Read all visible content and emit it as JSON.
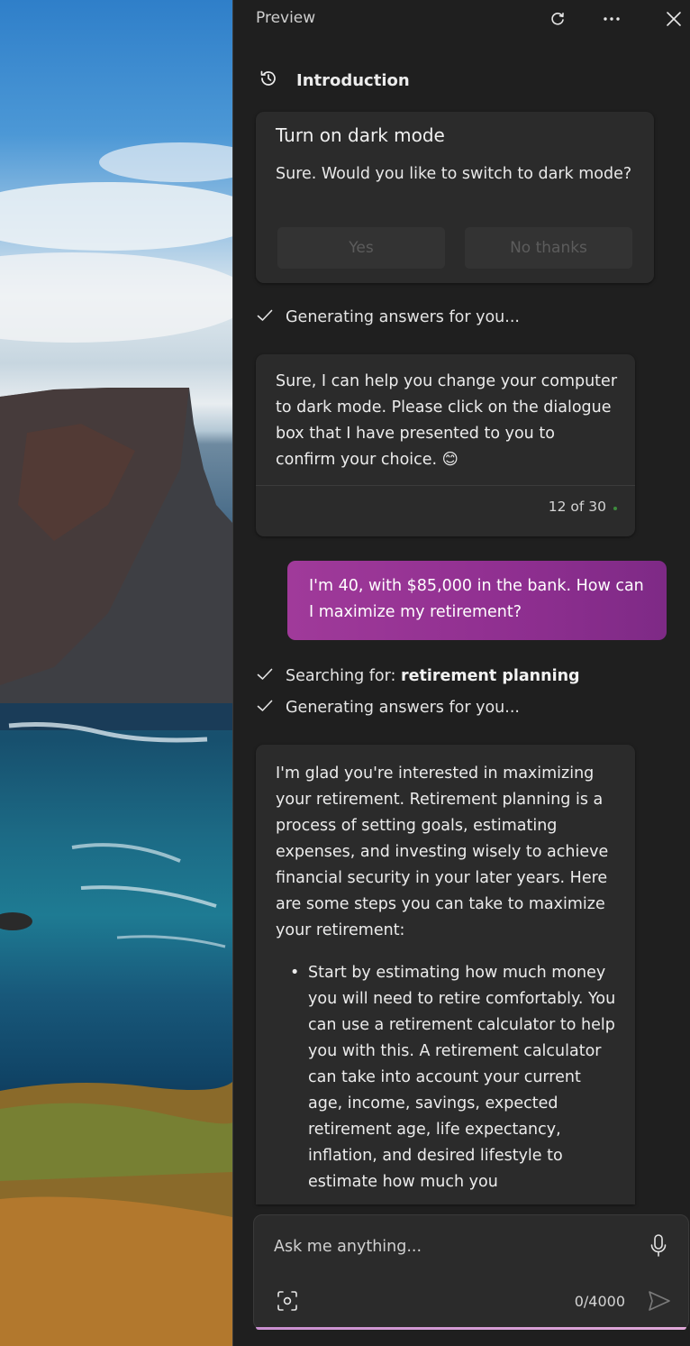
{
  "panel": {
    "title": "Preview"
  },
  "section": {
    "label": "Introduction"
  },
  "dialog_card": {
    "heading": "Turn on dark mode",
    "body": "Sure. Would you like to switch to dark mode?",
    "yes_label": "Yes",
    "no_label": "No thanks"
  },
  "status_1": {
    "text": "Generating answers for you..."
  },
  "answer_card_1": {
    "body": "Sure, I can help you change your computer to dark mode. Please click on the dialogue box that I have presented to you to confirm your choice. 😊",
    "count": "12 of 30"
  },
  "user_message": {
    "body": "I'm 40, with $85,000 in the bank. How can I maximize my retirement?"
  },
  "status_2": {
    "prefix": "Searching for: ",
    "query": "retirement planning"
  },
  "status_3": {
    "text": "Generating answers for you..."
  },
  "answer_card_2": {
    "paragraph": "I'm glad you're interested in maximizing your retirement. Retirement planning is a process of setting goals, estimating expenses, and investing wisely to achieve financial security in your later years. Here are some steps you can take to maximize your retirement:",
    "bullets": [
      "Start by estimating how much money you will need to retire comfortably. You can use a retirement calculator to help you with this. A retirement calculator can take into account your current age, income, savings, expected retirement age, life expectancy, inflation, and desired lifestyle to estimate how much you"
    ]
  },
  "composer": {
    "placeholder": "Ask me anything...",
    "counter": "0/4000"
  },
  "colors": {
    "panel_bg": "#1f1f1f",
    "card_bg": "#2b2b2b",
    "user_bubble": "#9a3596",
    "composer_underline": "#d49ad4"
  },
  "icons": [
    "refresh-icon",
    "more-icon",
    "close-icon",
    "history-icon",
    "check-icon",
    "mic-icon",
    "screenshot-icon",
    "send-icon"
  ]
}
